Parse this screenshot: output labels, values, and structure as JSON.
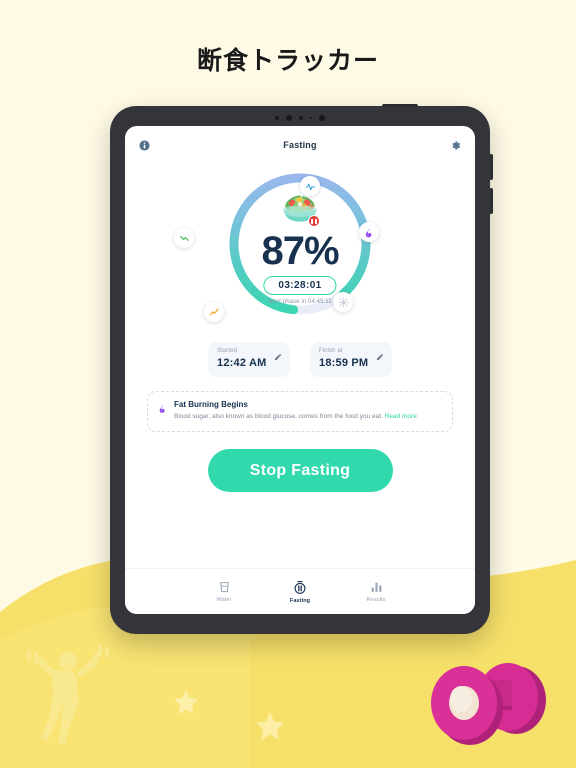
{
  "page": {
    "title": "断食トラッカー",
    "background_color": "#FEFAE6",
    "accent_yellow": "#F7E06A"
  },
  "app": {
    "header": {
      "title": "Fasting",
      "info_icon": "info-icon",
      "settings_icon": "gear-icon"
    },
    "progress": {
      "percent_label": "87%",
      "percent_value": 87,
      "timer": "03:28:01",
      "next_phase": "Next phase in 04:45:11",
      "center_emoji": "salad-bowl",
      "status_badge": "paused",
      "ring_colors": {
        "start": "#31d9ad",
        "mid": "#6ec9d9",
        "end": "#9fb2f0",
        "track": "#e9edf7"
      },
      "nodes": [
        {
          "name": "pulse-phase-node",
          "icon": "pulse-icon",
          "color": "#3aa9e0",
          "state": "reached"
        },
        {
          "name": "fat-burning-phase-node",
          "icon": "flame-icon",
          "color": "#8b3ff0",
          "state": "current"
        },
        {
          "name": "autophagy-phase-node",
          "icon": "sun-icon",
          "color": "#c3cbd8",
          "state": "locked"
        },
        {
          "name": "growth-phase-node",
          "icon": "chart-up-orange-icon",
          "color": "#f6a126",
          "state": "reached"
        },
        {
          "name": "ketosis-phase-node",
          "icon": "chart-down-green-icon",
          "color": "#4fbf57",
          "state": "reached"
        }
      ]
    },
    "time_cards": [
      {
        "name": "started-card",
        "label": "Started",
        "value": "12:42 AM",
        "edit_icon": "pencil-icon"
      },
      {
        "name": "finish-card",
        "label": "Finish at",
        "value": "18:59 PM",
        "edit_icon": "pencil-icon"
      }
    ],
    "info_card": {
      "icon": "flame-icon",
      "title": "Fat Burning Begins",
      "body": "Blood sugar, also known as blood glucose, comes from the food you eat.",
      "link_label": "Read more"
    },
    "cta": {
      "label": "Stop Fasting",
      "color": "#31d9ad"
    },
    "bottom_nav": [
      {
        "name": "nav-water",
        "label": "Water",
        "icon": "water-glass-icon",
        "active": false
      },
      {
        "name": "nav-fasting",
        "label": "Fasting",
        "icon": "fasting-timer-icon",
        "active": true
      },
      {
        "name": "nav-results",
        "label": "Results",
        "icon": "bar-chart-icon",
        "active": false
      }
    ]
  },
  "decorations": {
    "figure": "exercising-person-silhouette",
    "dumbbell": "pink-3d-dumbbell",
    "stars": [
      "star-1",
      "star-2"
    ]
  }
}
